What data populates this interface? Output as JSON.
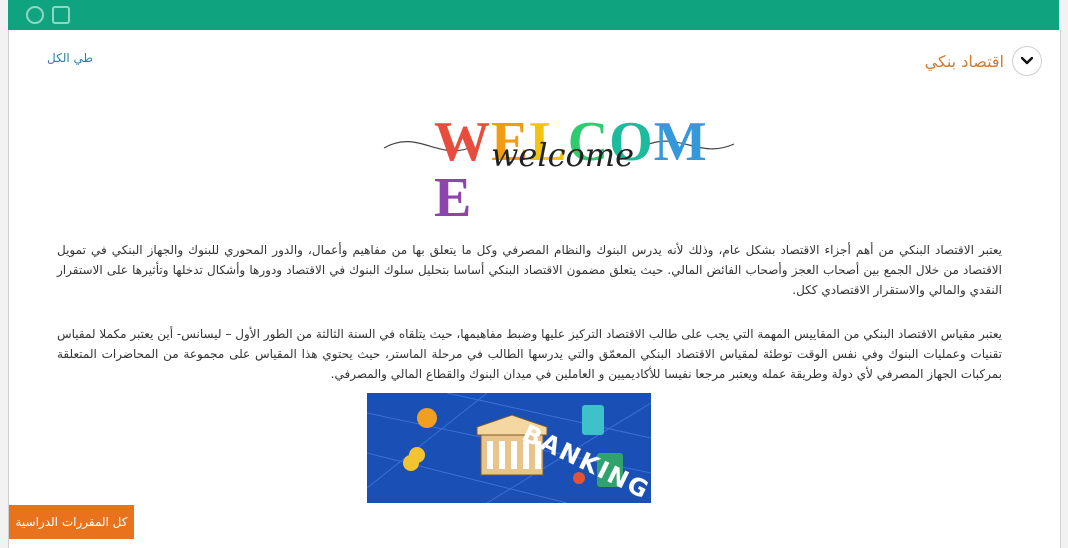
{
  "section": {
    "title": "اقتصاد بنكي",
    "collapse_all": "طي الكل",
    "chevron_icon": "chevron-down-icon"
  },
  "welcome": {
    "letters": [
      "W",
      "E",
      "L",
      "C",
      "O",
      "M",
      "E"
    ],
    "letter_colors": [
      "#e74c3c",
      "#f39c12",
      "#f1c40f",
      "#2ecc71",
      "#1abc9c",
      "#3498db",
      "#8e44ad"
    ],
    "script": "welcome"
  },
  "paragraphs": [
    "يعتبر الاقتصاد البنكي من أهم أجزاء الاقتصاد بشكل عام، وذلك لأنه يدرس البنوك والنظام المصرفي وكل ما يتعلق بها من مفاهيم وأعمال، والدور المحوري للبنوك والجهاز البنكي في تمويل الاقتصاد من خلال الجمع بين أصحاب العجز وأصحاب الفائض المالي. حيث يتعلق مضمون الاقتصاد البنكي أساسا بتحليل سلوك البنوك في الاقتصاد ودورها وأشكال تدخلها وتأثيرها على الاستقرار النقدي والمالي والاستقرار الاقتصادي ككل.",
    "يعتبر مقياس الاقتصاد البنكي من المقاييس المهمة التي يجب على طالب الاقتصاد التركيز عليها وضبط مفاهيمها، حيث يتلقاه في السنة الثالثة من الطور الأول – ليسانس- أين يعتبر مكملا لمقياس تقنيات وعمليات البنوك وفي نفس الوقت توطئة لمقياس الاقتصاد البنكي المعمّق والتي يدرسها الطالب في مرحلة الماستر، حيث يحتوي هذا المقياس على مجموعة من المحاضرات المتعلقة بمركبات الجهاز المصرفي لأي دولة وطريقة عمله ويعتبر مرجعا نفيسا للأكاديميين و العاملين في ميدان البنوك والقطاع المالي والمصرفي."
  ],
  "banner": {
    "word": "BANKING",
    "background": "#1a4fb6"
  },
  "footer": {
    "courses_button": "كل المقررات الدراسية"
  },
  "colors": {
    "accent": "#e8731c",
    "topbar": "#10a37f",
    "link": "#2b7fa7"
  }
}
